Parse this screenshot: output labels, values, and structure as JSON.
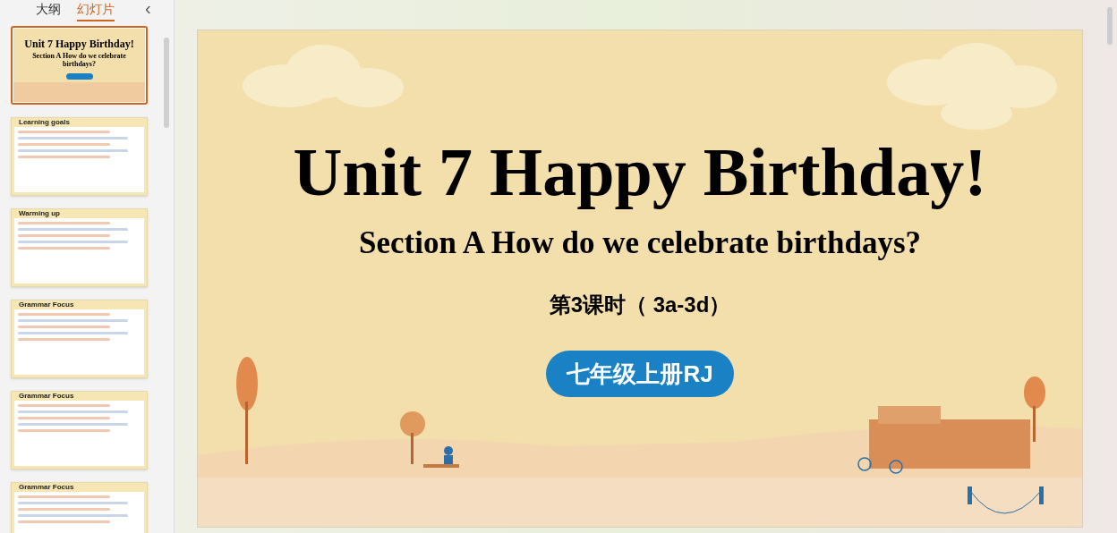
{
  "panel_tabs": [
    {
      "label": "大纲",
      "selected": false
    },
    {
      "label": "幻灯片",
      "selected": true
    }
  ],
  "collapse_button": {
    "label": "‹"
  },
  "thumbnails": [
    {
      "kind": "title",
      "selected": true,
      "title": "Unit 7 Happy Birthday!",
      "subtitle": "Section A How do we celebrate birthdays?"
    },
    {
      "kind": "content",
      "selected": false,
      "heading": "Learning goals"
    },
    {
      "kind": "content",
      "selected": false,
      "heading": "Warming up"
    },
    {
      "kind": "content",
      "selected": false,
      "heading": "Grammar Focus"
    },
    {
      "kind": "content",
      "selected": false,
      "heading": "Grammar Focus"
    },
    {
      "kind": "content",
      "selected": false,
      "heading": "Grammar Focus"
    }
  ],
  "slide": {
    "title": "Unit 7 Happy Birthday!",
    "subtitle": "Section A How do we celebrate birthdays?",
    "lesson": "第3课时（ 3a-3d）",
    "badge": "七年级上册RJ"
  }
}
